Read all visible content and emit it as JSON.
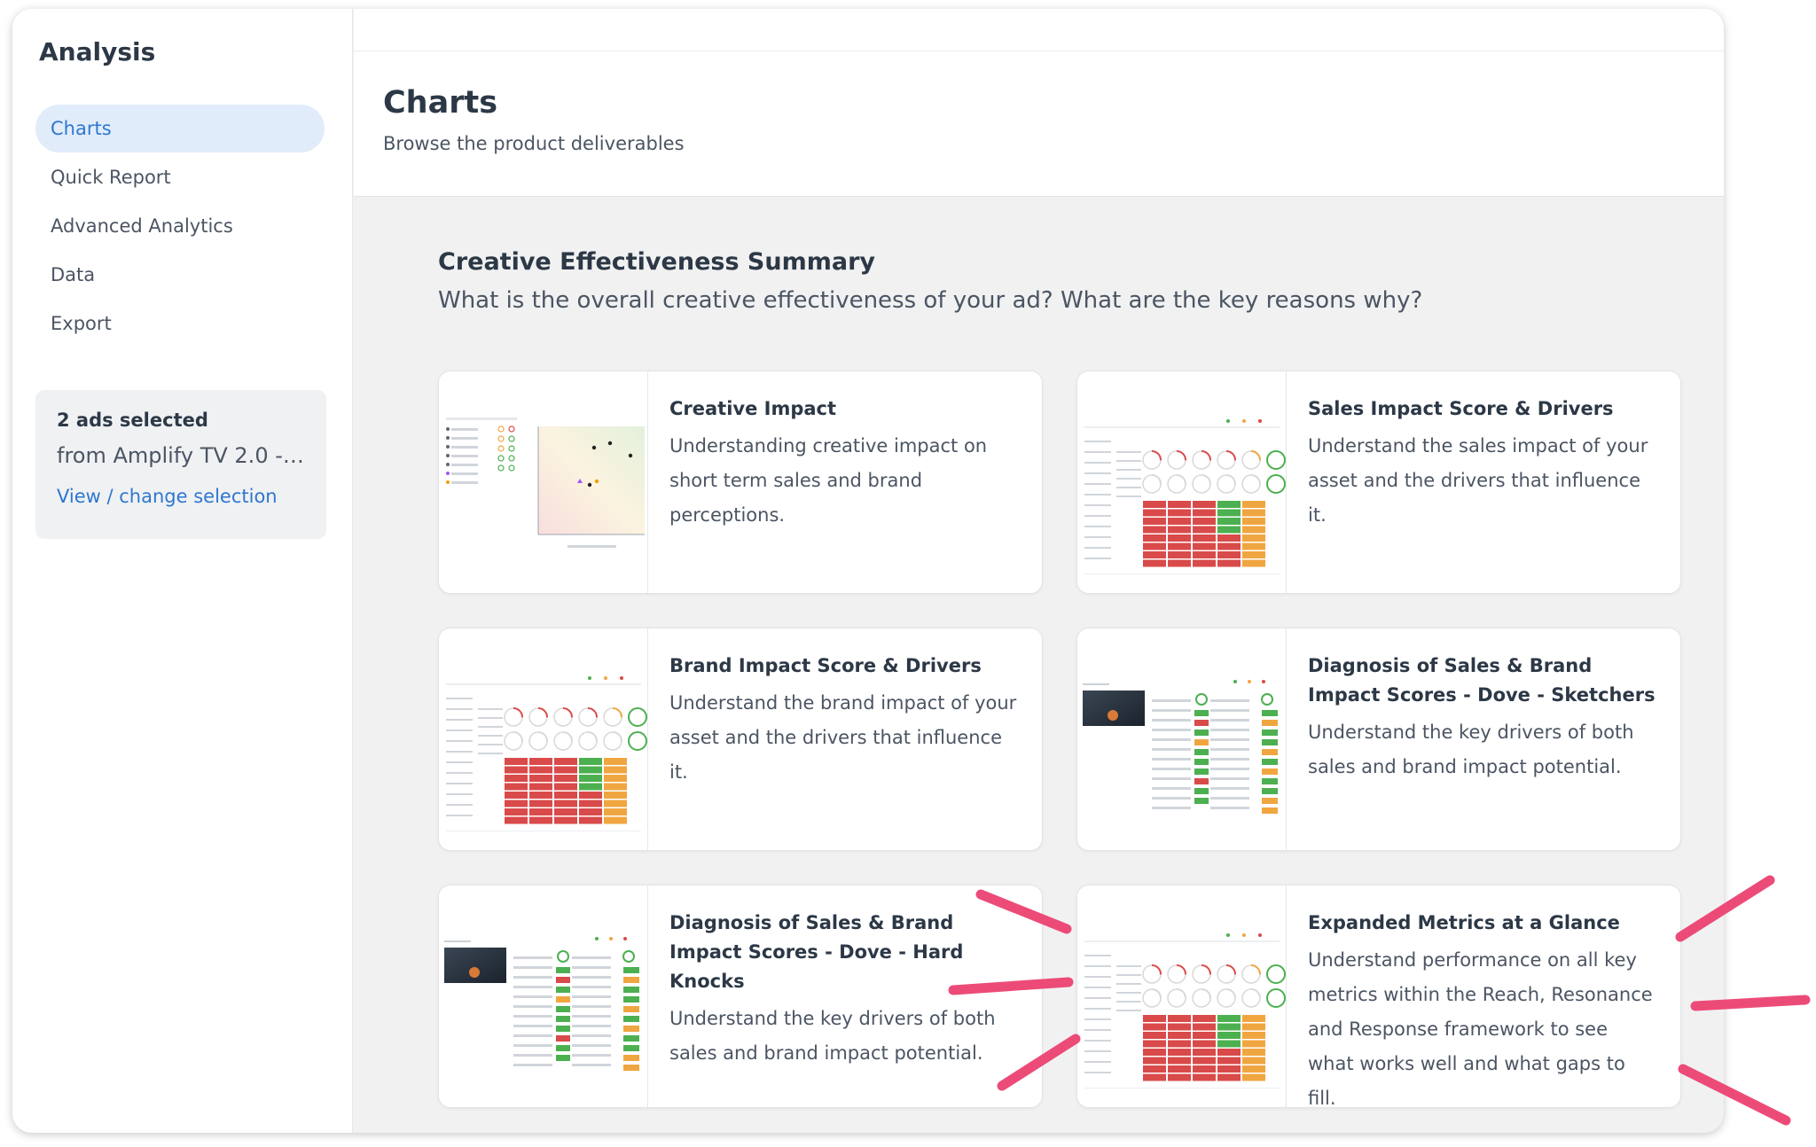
{
  "sidebar": {
    "title": "Analysis",
    "items": [
      {
        "label": "Charts",
        "active": true
      },
      {
        "label": "Quick Report"
      },
      {
        "label": "Advanced Analytics"
      },
      {
        "label": "Data"
      },
      {
        "label": "Export"
      }
    ],
    "selection": {
      "count": "2 ads selected",
      "from": "from Amplify TV 2.0 - C...",
      "link": "View / change selection"
    }
  },
  "header": {
    "title": "Charts",
    "subtitle": "Browse the product deliverables"
  },
  "section": {
    "title": "Creative Effectiveness Summary",
    "subtitle": "What is the overall creative effectiveness of your ad? What are the key reasons why?"
  },
  "cards": [
    {
      "title": "Creative Impact",
      "desc": "Understanding creative impact on short term sales and brand perceptions.",
      "thumb": "scatter-thumbnail"
    },
    {
      "title": "Sales Impact Score & Drivers",
      "desc": "Understand the sales impact of your asset and the drivers that influence it.",
      "thumb": "score-grid-thumbnail"
    },
    {
      "title": "Brand Impact Score & Drivers",
      "desc": "Understand the brand impact of your asset and the drivers that influence it.",
      "thumb": "score-grid-thumbnail"
    },
    {
      "title": "Diagnosis of Sales & Brand Impact Scores - Dove - Sketchers",
      "desc": "Understand the key drivers of both sales and brand impact potential.",
      "thumb": "diagnosis-thumbnail"
    },
    {
      "title": "Diagnosis of Sales & Brand Impact Scores - Dove - Hard Knocks",
      "desc": "Understand the key drivers of both sales and brand impact potential.",
      "thumb": "diagnosis-thumbnail"
    },
    {
      "title": "Expanded Metrics at a Glance",
      "desc": "Understand performance on all key metrics within the Reach, Resonance and Response framework to see what works well and what gaps to fill.",
      "thumb": "score-grid-thumbnail"
    }
  ],
  "colors": {
    "accent": "#2e77d0",
    "active_bg": "#e1ecfa",
    "annotation": "#ec4b78",
    "score_red": "#d94a4a",
    "score_green": "#4cb050",
    "score_orange": "#f0a640"
  }
}
